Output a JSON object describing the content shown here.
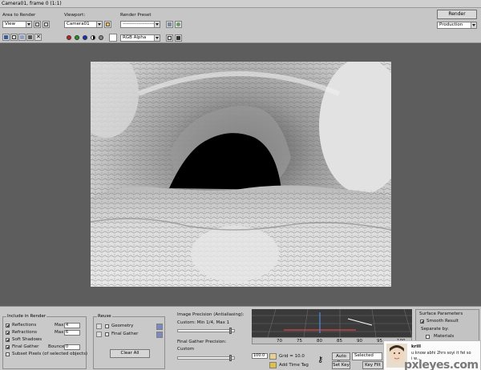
{
  "window": {
    "title": "Camera01, frame 0 (1:1)"
  },
  "toolbar": {
    "area_label": "Area to Render",
    "area_value": "View",
    "viewport_label": "Viewport:",
    "viewport_value": "Camera01",
    "preset_label": "Render Preset",
    "preset_value": "----------------------",
    "render_label": "Render",
    "production_value": "Production",
    "channel_value": "RGB Alpha"
  },
  "include_panel": {
    "title": "Include in Render",
    "reflections": "Reflections",
    "refractions": "Refractions",
    "soft_shadows": "Soft Shadows",
    "final_gather": "Final Gather",
    "subset": "Subset Pixels (of selected objects)",
    "max1_label": "Max",
    "max1_value": "4",
    "max2_label": "Max",
    "max2_value": "6",
    "bounces_label": "Bounces",
    "bounces_value": "0"
  },
  "reuse_panel": {
    "title": "Reuse",
    "geometry": "Geometry",
    "final_gather": "Final Gather",
    "clear_all": "Clear All"
  },
  "precision_panel": {
    "image_label": "Image Precision (Antialiasing):",
    "image_value": "Custom: Min 1/4, Max 1",
    "fg_label": "Final Gather Precision:",
    "fg_value": "Custom"
  },
  "timeline": {
    "ticks": [
      "70",
      "75",
      "80",
      "85",
      "90",
      "95",
      "100"
    ],
    "frame_value": "100.0",
    "grid_label": "Grid = 10.0",
    "add_time_tag": "Add Time Tag",
    "auto_key": "Auto Key",
    "selected": "Selected",
    "set_key": "Set Key",
    "key_filters": "Key Filt"
  },
  "right_panel": {
    "title": "Surface Parameters",
    "smooth_result": "Smooth Result",
    "separate_by": "Separate by:",
    "materials": "Materials"
  },
  "chat": {
    "user": "krill",
    "line1": "u know abhi 2hrs soyi it fel so",
    "line2": "i w..."
  },
  "watermark": "pxleyes.com",
  "colors": {
    "red": "#d21a1a",
    "green": "#1a9a1a",
    "blue": "#1a2ad2",
    "ui_bg": "#c6c6c6",
    "canvas_bg": "#5d5d5d"
  }
}
